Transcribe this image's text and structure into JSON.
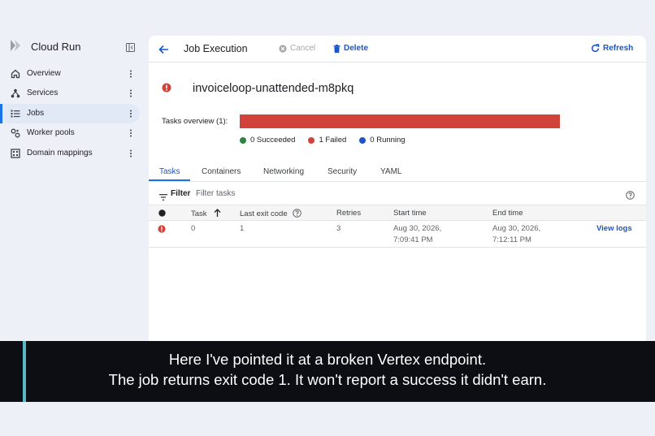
{
  "app": {
    "title": "Cloud Run"
  },
  "sidebar": {
    "items": [
      {
        "label": "Overview",
        "icon": "home-icon"
      },
      {
        "label": "Services",
        "icon": "services-icon"
      },
      {
        "label": "Jobs",
        "icon": "list-icon",
        "active": true
      },
      {
        "label": "Worker pools",
        "icon": "worker-pools-icon"
      },
      {
        "label": "Domain mappings",
        "icon": "domain-icon"
      }
    ]
  },
  "toolbar": {
    "title": "Job Execution",
    "cancel_label": "Cancel",
    "delete_label": "Delete",
    "refresh_label": "Refresh"
  },
  "execution": {
    "name": "invoiceloop-unattended-m8pkq",
    "status": "failed"
  },
  "overview": {
    "label": "Tasks overview (1):",
    "failed_fraction": 1.0,
    "legend": {
      "succeeded": "0 Succeeded",
      "failed": "1 Failed",
      "running": "0 Running"
    }
  },
  "tabs": [
    "Tasks",
    "Containers",
    "Networking",
    "Security",
    "YAML"
  ],
  "filter": {
    "label": "Filter",
    "placeholder": "Filter tasks"
  },
  "table": {
    "headers": {
      "task": "Task",
      "last_exit_code": "Last exit code",
      "retries": "Retries",
      "start_time": "Start time",
      "end_time": "End time"
    },
    "rows": [
      {
        "task": "0",
        "last_exit_code": "1",
        "retries": "3",
        "start_date": "Aug 30, 2026,",
        "start_clock": "7:09:41 PM",
        "end_date": "Aug 30, 2026,",
        "end_clock": "7:12:11 PM",
        "action": "View logs"
      }
    ]
  },
  "caption": {
    "line1": "Here I've pointed it at a broken Vertex endpoint.",
    "line2": "The job returns exit code 1. It won't report a success it didn't earn."
  },
  "colors": {
    "accent": "#1a73e8",
    "error": "#d0423a",
    "success": "#2e8540",
    "running": "#1a56c8"
  }
}
